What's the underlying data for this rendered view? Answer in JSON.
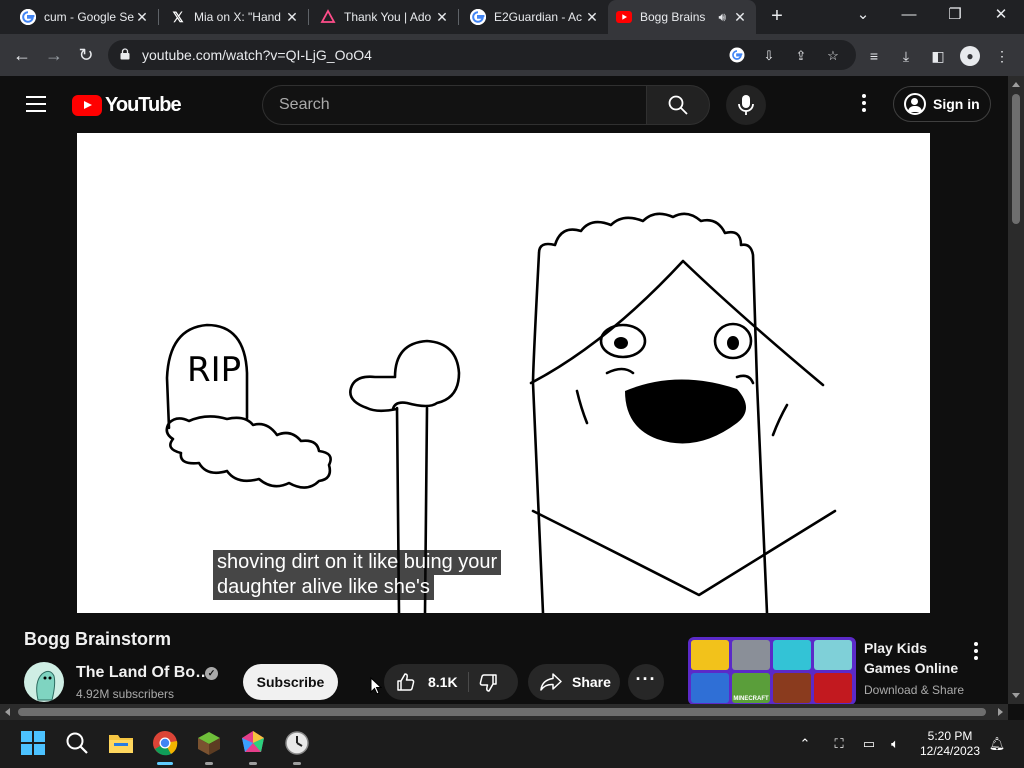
{
  "browser": {
    "tabs": [
      {
        "title": "cum - Google Se",
        "favicon": "google-g-icon"
      },
      {
        "title": "Mia on X: \"Hand",
        "favicon": "x-logo-icon"
      },
      {
        "title": "Thank You | Ado",
        "favicon": "adobe-acrobat-icon"
      },
      {
        "title": "E2Guardian - Ac",
        "favicon": "google-g-icon"
      },
      {
        "title": "Bogg Brains",
        "favicon": "youtube-icon",
        "active": true,
        "audio": true
      }
    ],
    "url": "youtube.com/watch?v=QI-LjG_OoO4"
  },
  "youtube": {
    "search_placeholder": "Search",
    "sign_in_label": "Sign in",
    "logo_text": "YouTube"
  },
  "video": {
    "caption_lines": [
      "shoving dirt on it like buing your",
      "daughter alive like she's"
    ],
    "drawing_text": "RIP"
  },
  "meta": {
    "title": "Bogg Brainstorm",
    "channel_name": "The Land Of Bo…",
    "subscribers": "4.92M subscribers",
    "subscribe_label": "Subscribe",
    "likes": "8.1K",
    "share_label": "Share",
    "more_label": "···"
  },
  "ad": {
    "title": "Play Kids Games Online",
    "subtitle": "Download & Share",
    "thumb_text": "MINECRAFT"
  },
  "taskbar": {
    "time": "5:20 PM",
    "date": "12/24/2023"
  },
  "colors": {
    "youtube_red": "#ff0000",
    "background": "#0f0f0f",
    "chrome_tabbar": "#202124",
    "chrome_toolbar": "#35363a"
  }
}
